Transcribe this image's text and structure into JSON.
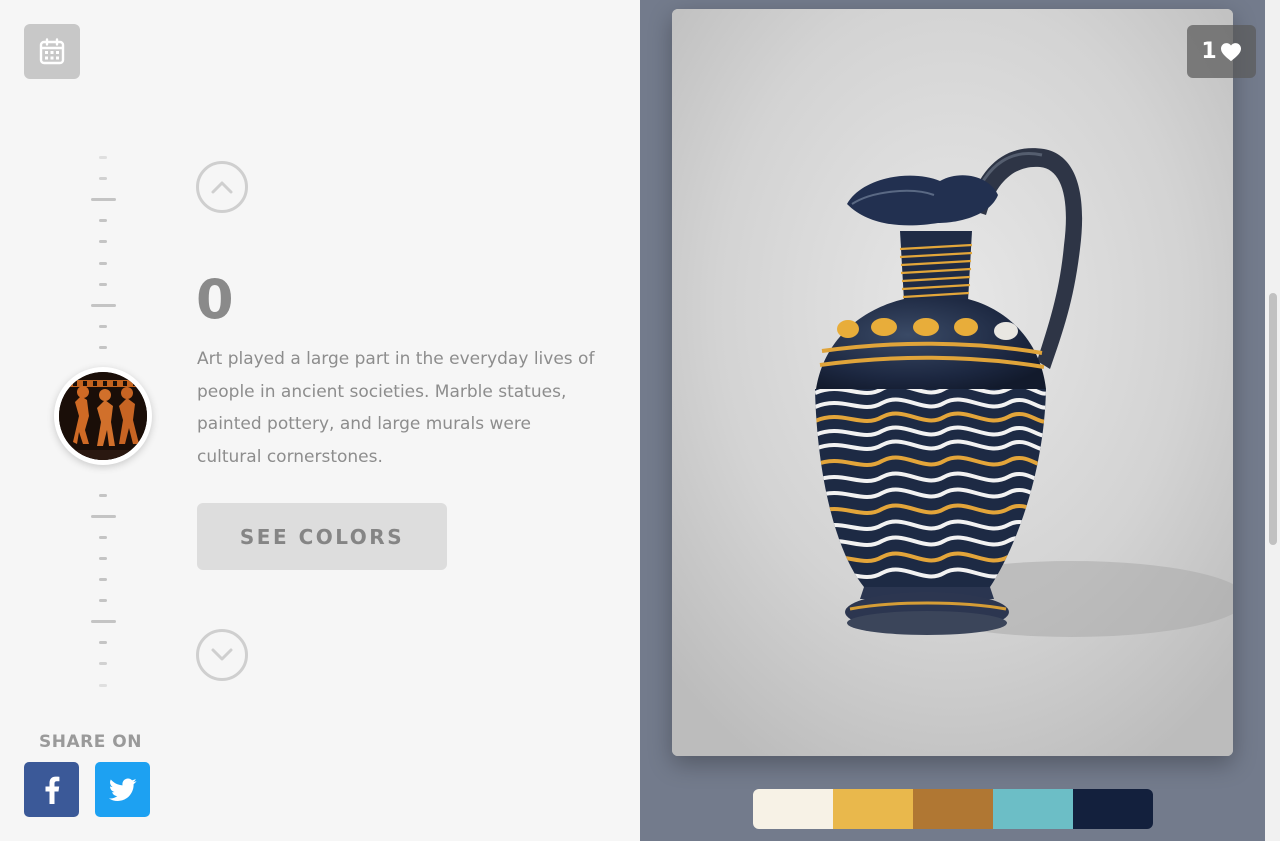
{
  "header": {
    "calendar_icon": "calendar-icon"
  },
  "timeline": {
    "current_index": 0,
    "description": "Art played a large part in the everyday lives of people in ancient societies. Marble statues, painted pottery, and large murals were cultural cornerstones.",
    "up_icon": "chevron-up-icon",
    "down_icon": "chevron-down-icon",
    "thumbnail": "ancient-red-figure-pottery-thumbnail"
  },
  "actions": {
    "see_colors_label": "SEE COLORS"
  },
  "share": {
    "label": "SHARE ON",
    "facebook_icon": "facebook-icon",
    "twitter_icon": "twitter-icon"
  },
  "artwork": {
    "likes": "1",
    "like_icon": "heart-icon",
    "subject": "ancient-glass-jug-image"
  },
  "palette": {
    "colors": [
      "#f7f2e6",
      "#e9b84c",
      "#b07733",
      "#6cbec6",
      "#13203d"
    ]
  },
  "theme": {
    "right_panel_bg": "#737b8c",
    "facebook": "#3b5998",
    "twitter": "#1da1f2"
  }
}
